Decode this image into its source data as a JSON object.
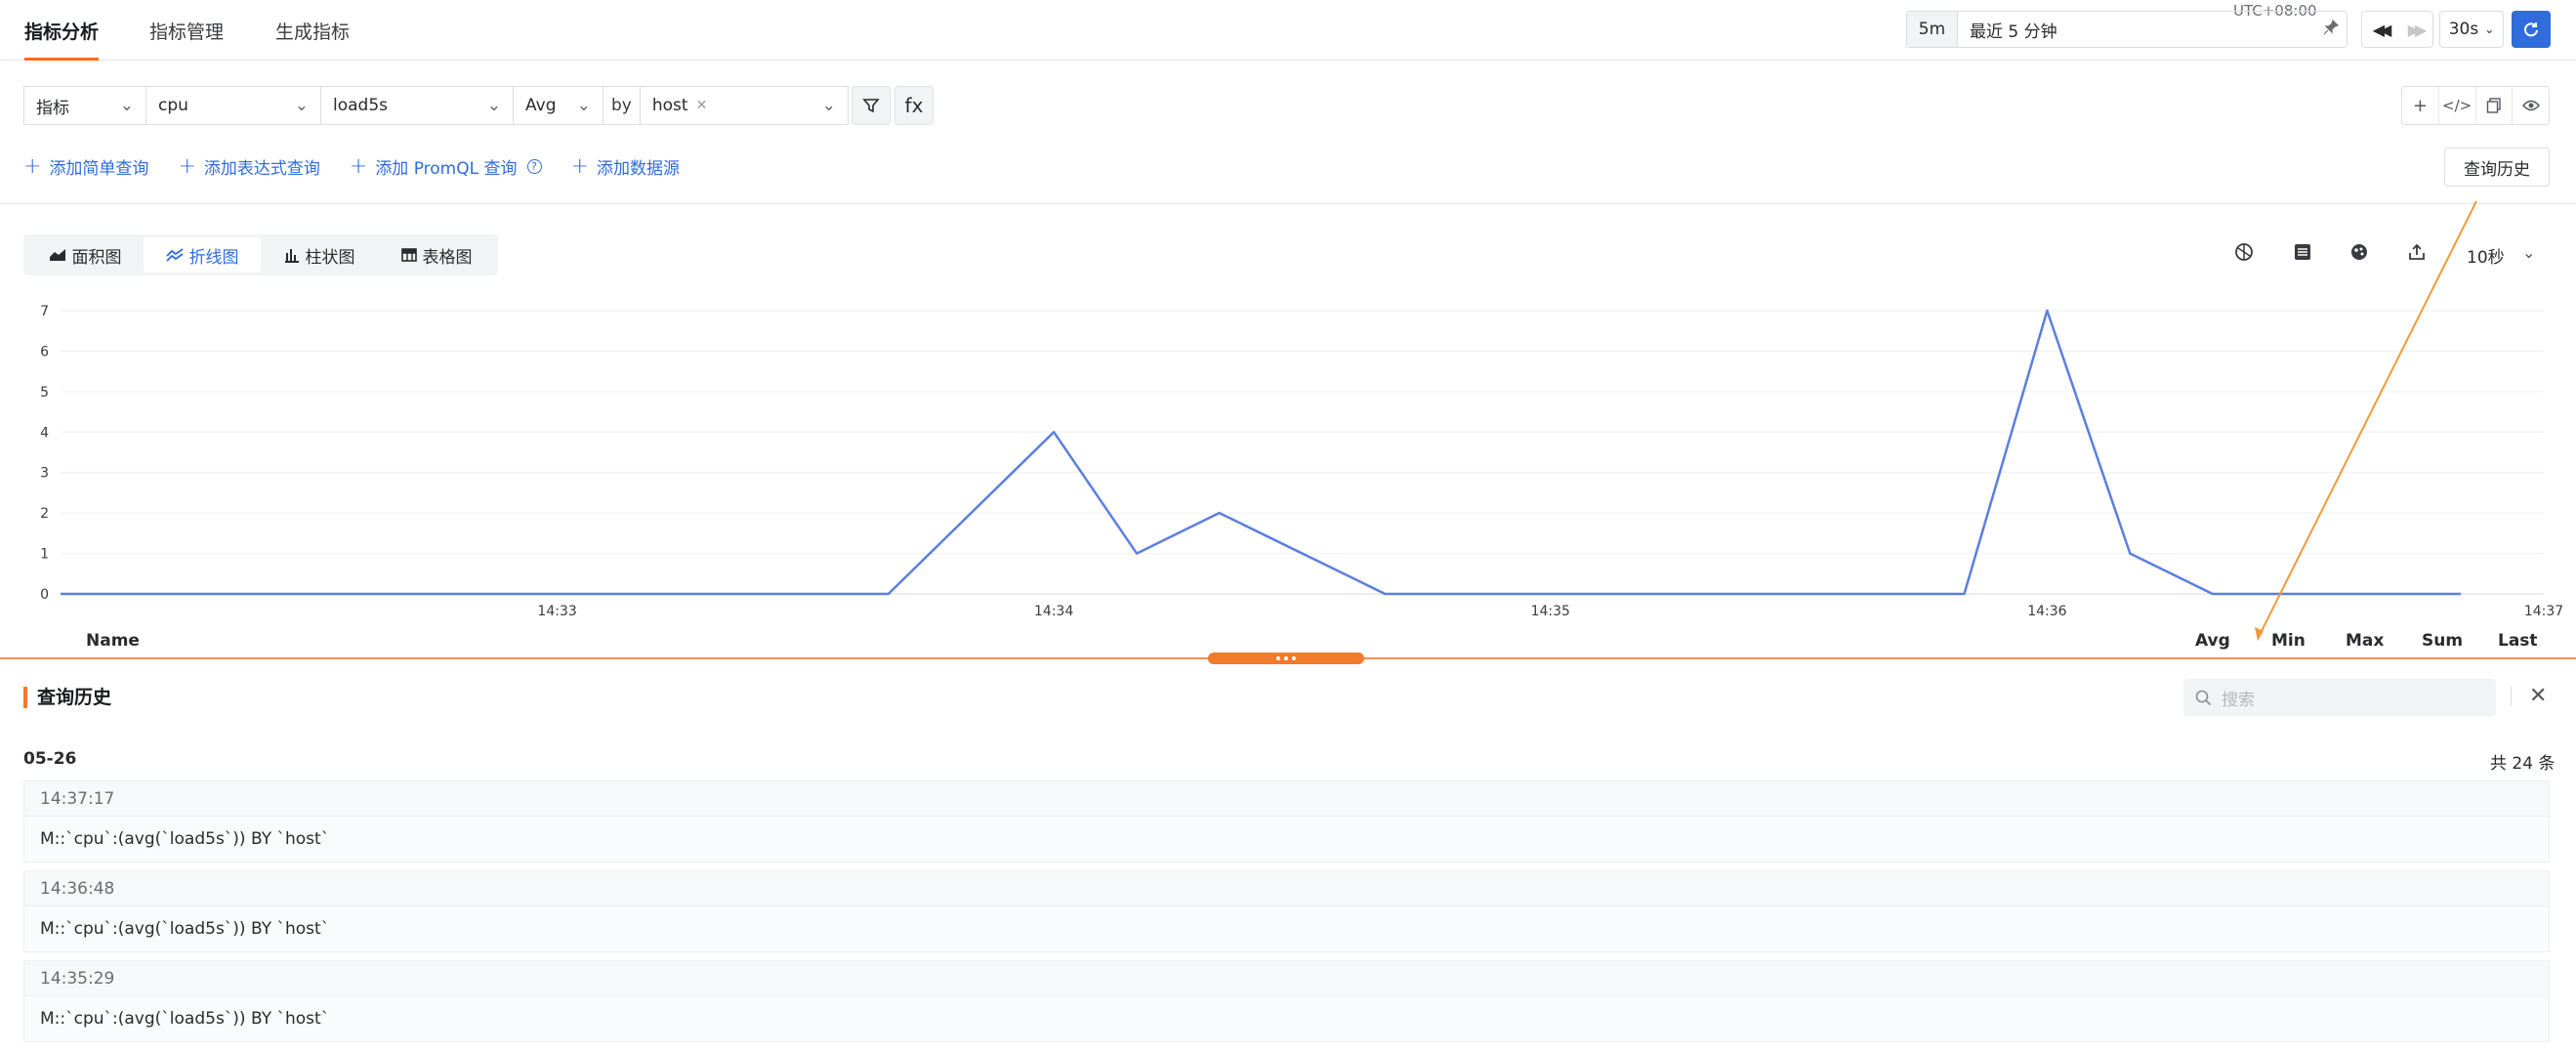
{
  "nav": {
    "tabs": [
      {
        "label": "指标分析",
        "active": true
      },
      {
        "label": "指标管理",
        "active": false
      },
      {
        "label": "生成指标",
        "active": false
      }
    ],
    "timezone": "UTC+08:00",
    "time_quick": "5m",
    "time_range": "最近 5 分钟",
    "refresh_interval": "30s"
  },
  "query": {
    "type": "指标",
    "measurement": "cpu",
    "field": "load5s",
    "aggregation": "Avg",
    "by_label": "by",
    "group_by_tag": "host",
    "filter_icon": "filter-icon",
    "fx_label": "fx"
  },
  "add_links": {
    "simple": "添加简单查询",
    "expression": "添加表达式查询",
    "promql": "添加 PromQL 查询",
    "datasource": "添加数据源"
  },
  "history_button": "查询历史",
  "view_tabs": [
    {
      "label": "面积图",
      "icon": "area-chart-icon",
      "active": false
    },
    {
      "label": "折线图",
      "icon": "line-chart-icon",
      "active": true
    },
    {
      "label": "柱状图",
      "icon": "bar-chart-icon",
      "active": false
    },
    {
      "label": "表格图",
      "icon": "table-icon",
      "active": false
    }
  ],
  "interval": "10秒",
  "legend_headers": {
    "name": "Name",
    "avg": "Avg",
    "min": "Min",
    "max": "Max",
    "sum": "Sum",
    "last": "Last"
  },
  "colors": {
    "accent": "#2f6cdc",
    "series": "#5b7fe0",
    "orange": "#f07a2d"
  },
  "chart_data": {
    "type": "line",
    "ylim": [
      0,
      7
    ],
    "y_ticks": [
      0,
      1,
      2,
      3,
      4,
      5,
      6,
      7
    ],
    "x_ticks": [
      "14:33",
      "14:34",
      "14:35",
      "14:36",
      "14:37"
    ],
    "x_range_minutes": [
      32.0,
      37.0
    ],
    "series": [
      {
        "x": [
          32.0,
          33.0,
          33.667,
          34.0,
          34.167,
          34.333,
          34.667,
          35.0,
          35.5,
          35.833,
          36.0,
          36.167,
          36.333,
          36.833
        ],
        "values": [
          0,
          0,
          0,
          4,
          1,
          2,
          0,
          0,
          0,
          0,
          7,
          1,
          0,
          0
        ]
      }
    ]
  },
  "history": {
    "title": "查询历史",
    "search_placeholder": "搜索",
    "date": "05-26",
    "count": "共 24 条",
    "items": [
      {
        "time": "14:37:17",
        "query": "M::`cpu`:(avg(`load5s`)) BY `host`"
      },
      {
        "time": "14:36:48",
        "query": "M::`cpu`:(avg(`load5s`)) BY `host`"
      },
      {
        "time": "14:35:29",
        "query": "M::`cpu`:(avg(`load5s`)) BY `host`"
      }
    ]
  }
}
